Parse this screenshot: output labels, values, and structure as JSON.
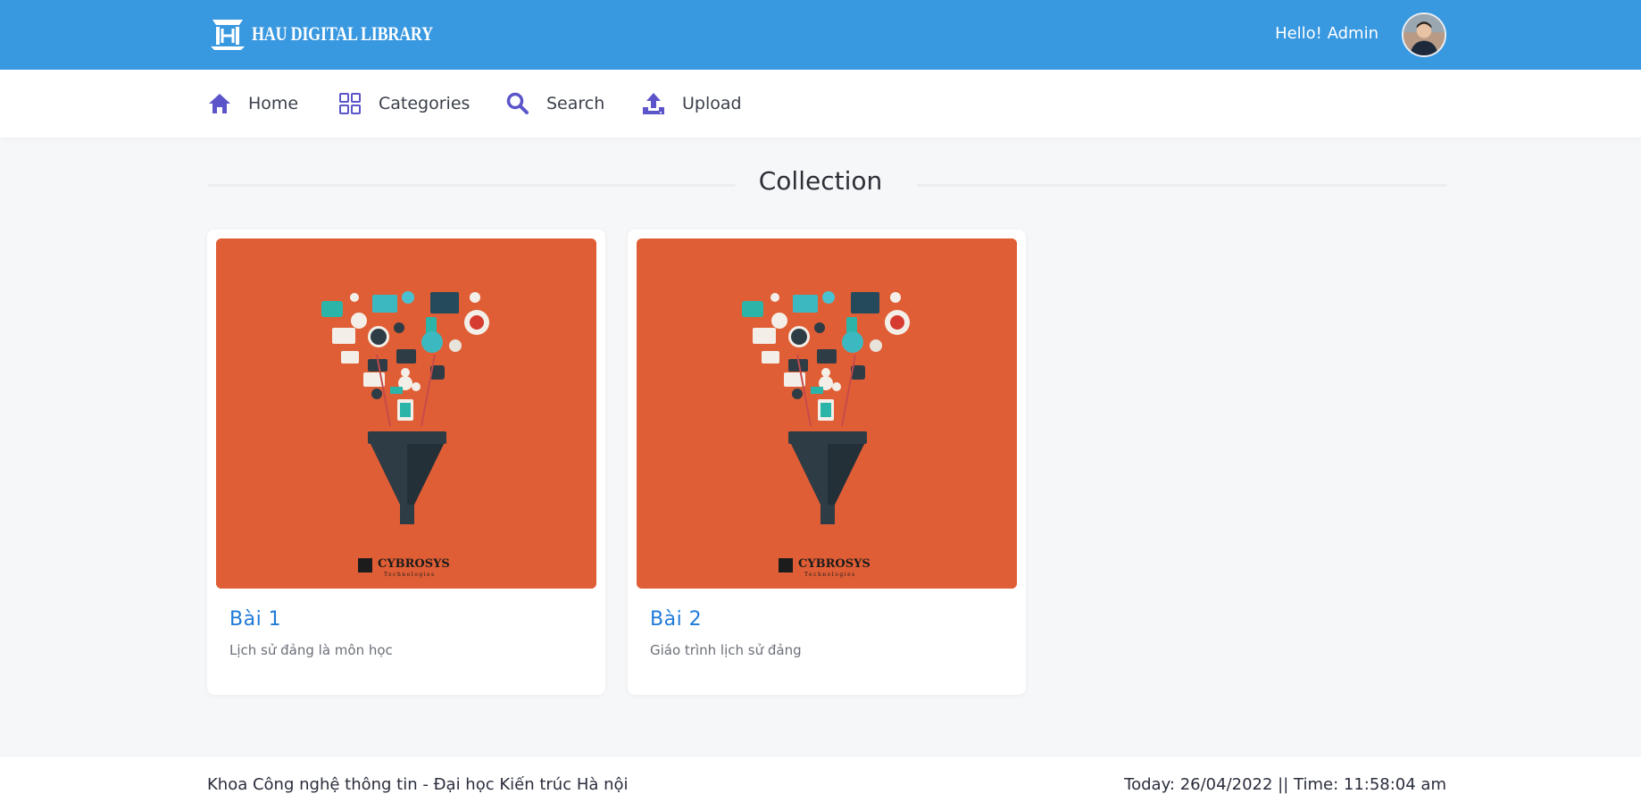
{
  "header": {
    "logo_text": "HAU DIGITAL LIBRARY",
    "greeting": "Hello! Admin",
    "background": "#3898e0"
  },
  "nav": {
    "items": [
      {
        "label": "Home",
        "icon": "home-icon"
      },
      {
        "label": "Categories",
        "icon": "grid-icon"
      },
      {
        "label": "Search",
        "icon": "search-icon"
      },
      {
        "label": "Upload",
        "icon": "upload-icon"
      }
    ],
    "icon_color": "#5b55c9"
  },
  "main": {
    "section_title": "Collection",
    "cards": [
      {
        "title": "Bài 1",
        "description": "Lịch sử đảng là môn học",
        "image_caption": "CYBROSYS",
        "image_subcaption": "Technologies"
      },
      {
        "title": "Bài 2",
        "description": "Giáo trình lịch sử đảng",
        "image_caption": "CYBROSYS",
        "image_subcaption": "Technologies"
      }
    ]
  },
  "footer": {
    "left_text": "Khoa Công nghệ thông tin - Đại học Kiến trúc Hà nội",
    "right_text": "Today: 26/04/2022 || Time: 11:58:04 am"
  },
  "colors": {
    "accent": "#1f7ad8",
    "card_image_bg": "#e05e35"
  }
}
